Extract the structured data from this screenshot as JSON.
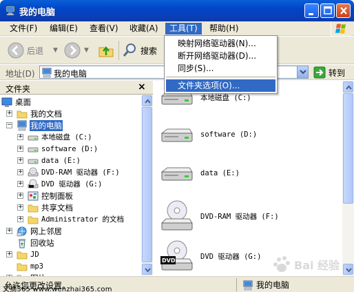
{
  "window": {
    "title": "我的电脑"
  },
  "menubar": {
    "items": [
      "文件(F)",
      "编辑(E)",
      "查看(V)",
      "收藏(A)",
      "工具(T)",
      "帮助(H)"
    ]
  },
  "tools_menu": {
    "items": [
      "映射网络驱动器(N)...",
      "断开网络驱动器(D)...",
      "同步(S)...",
      "文件夹选项(O)..."
    ],
    "highlighted": "文件夹选项(O)..."
  },
  "toolbar": {
    "back": "后退",
    "search": "搜索"
  },
  "address": {
    "label": "地址(D)",
    "value": "我的电脑",
    "go": "转到"
  },
  "folder_pane": {
    "title": "文件夹",
    "close": "×",
    "tree": [
      {
        "label": "桌面",
        "icon": "desktop-icon"
      },
      {
        "label": "我的文档",
        "icon": "folder-icon"
      },
      {
        "label": "我的电脑",
        "icon": "computer-icon"
      },
      {
        "label": "本地磁盘 (C:)",
        "icon": "drive-icon"
      },
      {
        "label": "software (D:)",
        "icon": "drive-icon"
      },
      {
        "label": "data (E:)",
        "icon": "drive-icon"
      },
      {
        "label": "DVD-RAM 驱动器 (F:)",
        "icon": "cd-drive-icon"
      },
      {
        "label": "DVD 驱动器 (G:)",
        "icon": "dvd-drive-icon"
      },
      {
        "label": "控制面板",
        "icon": "control-panel-icon"
      },
      {
        "label": "共享文档",
        "icon": "folder-icon"
      },
      {
        "label": "Administrator 的文档",
        "icon": "folder-icon"
      },
      {
        "label": "网上邻居",
        "icon": "network-icon"
      },
      {
        "label": "回收站",
        "icon": "recycle-bin-icon"
      },
      {
        "label": "JD",
        "icon": "folder-icon"
      },
      {
        "label": "mp3",
        "icon": "folder-icon"
      },
      {
        "label": "图片",
        "icon": "folder-icon"
      }
    ]
  },
  "content": {
    "drives": [
      {
        "label": "本地磁盘 (C:)",
        "icon": "hard-disk-icon"
      },
      {
        "label": "software (D:)",
        "icon": "hard-disk-icon"
      },
      {
        "label": "data (E:)",
        "icon": "hard-disk-icon"
      },
      {
        "label": "DVD-RAM 驱动器 (F:)",
        "icon": "cd-drive-icon"
      },
      {
        "label": "DVD 驱动器 (G:)",
        "icon": "dvd-drive-icon"
      }
    ]
  },
  "status": {
    "text": "允许您更改设置。",
    "location": "我的电脑"
  },
  "watermark": {
    "site": "www.wenzhai365.com",
    "baidu": "Bai 经验",
    "site_label": "文摘365"
  },
  "colors": {
    "titlebar": "#0046c8",
    "selection": "#316ac5",
    "chrome": "#ece9d8"
  }
}
